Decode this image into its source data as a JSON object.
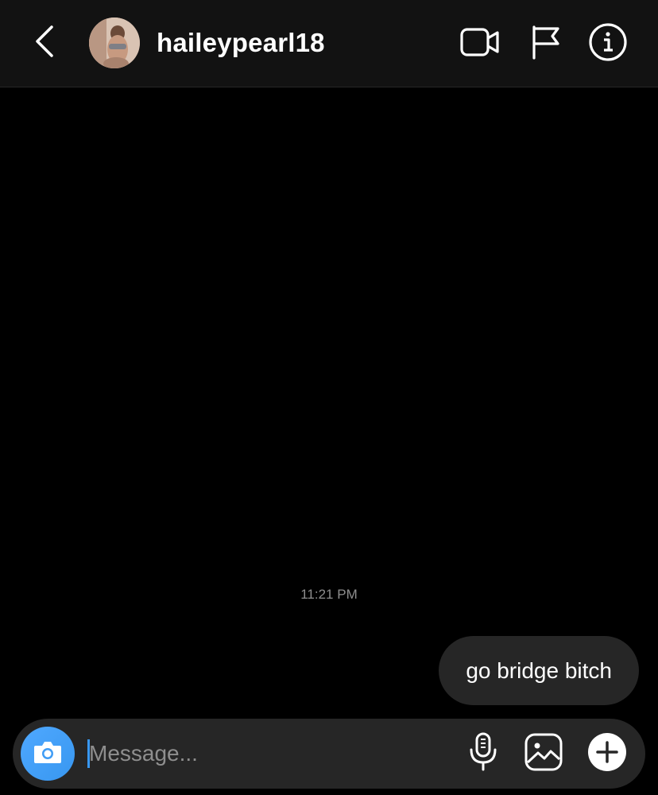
{
  "header": {
    "username": "haileypearl18",
    "icons": {
      "back": "chevron-left-icon",
      "video": "video-camera-icon",
      "report": "flag-icon",
      "info": "info-icon"
    }
  },
  "thread": {
    "timestamp": "11:21 PM",
    "messages": [
      {
        "sender": "me",
        "text": "go bridge bitch"
      }
    ]
  },
  "composer": {
    "placeholder": "Message...",
    "value": "",
    "icons": {
      "camera": "camera-icon",
      "microphone": "microphone-icon",
      "gallery": "gallery-icon",
      "more": "plus-icon"
    }
  },
  "colors": {
    "background": "#000000",
    "header_background": "#121212",
    "bubble": "#262626",
    "accent": "#3897f0",
    "muted_text": "#8e8e8e"
  }
}
